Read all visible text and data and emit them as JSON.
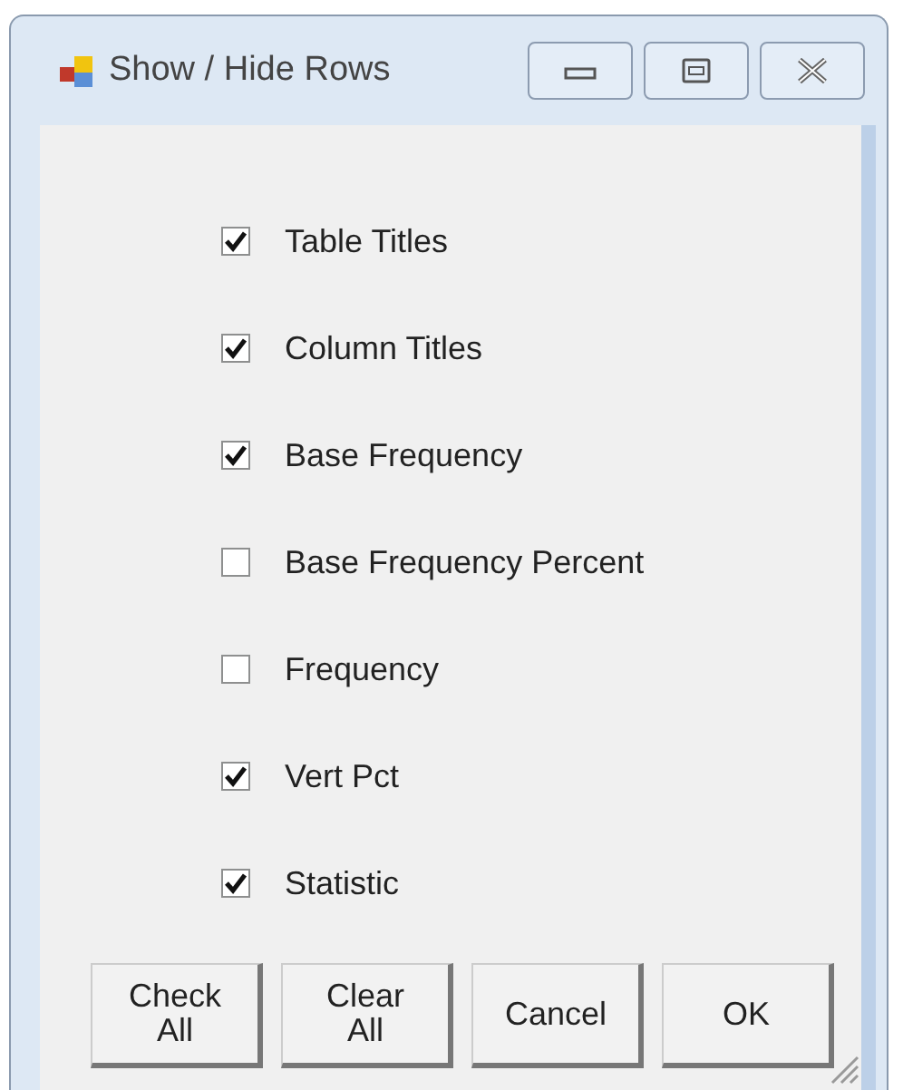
{
  "window": {
    "title": "Show / Hide Rows"
  },
  "rows": [
    {
      "label": "Table Titles",
      "checked": true
    },
    {
      "label": "Column Titles",
      "checked": true
    },
    {
      "label": "Base Frequency",
      "checked": true
    },
    {
      "label": "Base Frequency Percent",
      "checked": false
    },
    {
      "label": "Frequency",
      "checked": false
    },
    {
      "label": "Vert Pct",
      "checked": true
    },
    {
      "label": "Statistic",
      "checked": true
    }
  ],
  "buttons": [
    "Check\nAll",
    "Clear\nAll",
    "Cancel",
    "OK"
  ]
}
